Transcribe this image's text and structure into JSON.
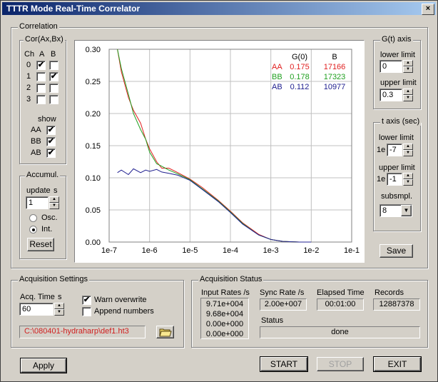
{
  "window": {
    "title": "TTTR Mode Real-Time Correlator",
    "close_glyph": "×"
  },
  "correlation": {
    "group_label": "Correlation",
    "cor_label": "Cor(Ax,Bx)",
    "col_ch": "Ch",
    "col_a": "A",
    "col_b": "B",
    "channels": [
      {
        "ch": "0",
        "a": true,
        "b": false
      },
      {
        "ch": "1",
        "a": false,
        "b": true
      },
      {
        "ch": "2",
        "a": false,
        "b": false
      },
      {
        "ch": "3",
        "a": false,
        "b": false
      }
    ],
    "show_label": "show",
    "show": [
      {
        "label": "AA",
        "checked": true
      },
      {
        "label": "BB",
        "checked": true
      },
      {
        "label": "AB",
        "checked": true
      }
    ]
  },
  "accumul": {
    "group_label": "Accumul.",
    "update_label": "update",
    "unit": "s",
    "update_value": "1",
    "osc_label": "Osc.",
    "int_label": "Int.",
    "mode": "Int.",
    "reset_label": "Reset"
  },
  "gt_axis": {
    "group_label": "G(t) axis",
    "lower_label": "lower limit",
    "lower_value": "0",
    "upper_label": "upper limit",
    "upper_value": "0.3"
  },
  "t_axis": {
    "group_label": "t axis (sec)",
    "lower_label": "lower limit",
    "lower_prefix": "1e",
    "lower_value": "-7",
    "upper_label": "upper limit",
    "upper_prefix": "1e",
    "upper_value": "-1",
    "subsmpl_label": "subsmpl.",
    "subsmpl_value": "8"
  },
  "save_label": "Save",
  "chart_data": {
    "type": "line",
    "x_scale": "log",
    "xlim": [
      1e-07,
      0.1
    ],
    "ylim": [
      0,
      0.3
    ],
    "x_tick_labels": [
      "1e-7",
      "1e-6",
      "1e-5",
      "1e-4",
      "1e-3",
      "1e-2",
      "1e-1"
    ],
    "y_tick_labels": [
      "0.00",
      "0.05",
      "0.10",
      "0.15",
      "0.20",
      "0.25",
      "0.30"
    ],
    "grid": true,
    "legend": {
      "header_g0": "G(0)",
      "header_b": "B",
      "rows": [
        {
          "name": "AA",
          "g0": "0.175",
          "b": "17166",
          "color": "#e02020"
        },
        {
          "name": "BB",
          "g0": "0.178",
          "b": "17323",
          "color": "#20a020"
        },
        {
          "name": "AB",
          "g0": "0.112",
          "b": "10977",
          "color": "#202090"
        }
      ]
    },
    "series": [
      {
        "name": "AA",
        "color": "#e02020",
        "x": [
          1.6e-07,
          2e-07,
          3e-07,
          4e-07,
          6e-07,
          8e-07,
          1e-06,
          1.5e-06,
          2e-06,
          3e-06,
          5e-06,
          1e-05,
          2e-05,
          5e-05,
          0.0001,
          0.0002,
          0.0005,
          0.001,
          0.002,
          0.005,
          0.01
        ],
        "y": [
          0.3,
          0.265,
          0.225,
          0.205,
          0.185,
          0.16,
          0.145,
          0.125,
          0.115,
          0.115,
          0.108,
          0.098,
          0.085,
          0.065,
          0.048,
          0.03,
          0.012,
          0.004,
          0.001,
          0.0,
          0.0
        ]
      },
      {
        "name": "BB",
        "color": "#20a020",
        "x": [
          1.6e-07,
          2e-07,
          3e-07,
          4e-07,
          6e-07,
          8e-07,
          1e-06,
          1.5e-06,
          2e-06,
          3e-06,
          5e-06,
          1e-05,
          2e-05,
          5e-05,
          0.0001,
          0.0002,
          0.0005,
          0.001,
          0.002,
          0.005,
          0.01
        ],
        "y": [
          0.3,
          0.27,
          0.23,
          0.2,
          0.175,
          0.16,
          0.14,
          0.122,
          0.118,
          0.112,
          0.106,
          0.097,
          0.083,
          0.064,
          0.047,
          0.029,
          0.011,
          0.004,
          0.001,
          0.0,
          0.0
        ]
      },
      {
        "name": "AB",
        "color": "#202090",
        "x": [
          1.6e-07,
          2e-07,
          3e-07,
          4e-07,
          6e-07,
          8e-07,
          1e-06,
          1.5e-06,
          2e-06,
          3e-06,
          5e-06,
          1e-05,
          2e-05,
          5e-05,
          0.0001,
          0.0002,
          0.0005,
          0.001,
          0.002,
          0.005,
          0.01
        ],
        "y": [
          0.108,
          0.112,
          0.105,
          0.114,
          0.108,
          0.112,
          0.11,
          0.113,
          0.109,
          0.107,
          0.104,
          0.096,
          0.082,
          0.063,
          0.046,
          0.028,
          0.011,
          0.004,
          0.001,
          0.0,
          0.0
        ]
      }
    ]
  },
  "acquisition_settings": {
    "group_label": "Acquisition Settings",
    "acq_time_label": "Acq. Time",
    "acq_time_unit": "s",
    "acq_time_value": "60",
    "warn_label": "Warn overwrite",
    "warn_checked": true,
    "append_label": "Append numbers",
    "append_checked": false,
    "file_path": "C:\\080401-hydraharp\\def1.ht3"
  },
  "acquisition_status": {
    "group_label": "Acquisition Status",
    "input_rates_label": "Input Rates /s",
    "input_rates": [
      "9.71e+004",
      "9.68e+004",
      "0.00e+000",
      "0.00e+000"
    ],
    "sync_rate_label": "Sync Rate /s",
    "sync_rate_value": "2.00e+007",
    "elapsed_label": "Elapsed Time",
    "elapsed_value": "00:01:00",
    "records_label": "Records",
    "records_value": "12887378",
    "status_label": "Status",
    "status_value": "done"
  },
  "buttons": {
    "apply": "Apply",
    "start": "START",
    "stop": "STOP",
    "exit": "EXIT"
  }
}
